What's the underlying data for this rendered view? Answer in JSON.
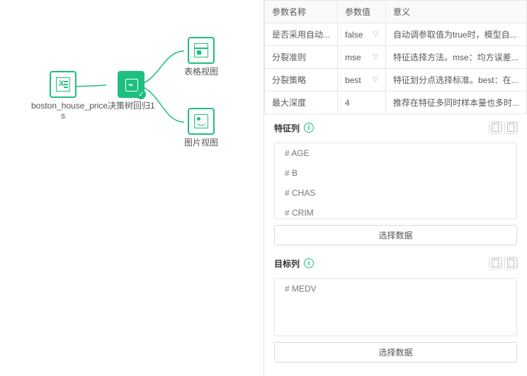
{
  "nodes": {
    "source": {
      "label": "boston_house_price\ns"
    },
    "mid": {
      "label": "决策树回归1"
    },
    "out1": {
      "label": "表格视图"
    },
    "out2": {
      "label": "图片视图"
    }
  },
  "paramTable": {
    "headers": [
      "参数名称",
      "参数值",
      "意义"
    ],
    "rows": [
      {
        "name": "是否采用自动...",
        "value": "false",
        "meaning": "自动调参取值为true时，模型自..."
      },
      {
        "name": "分裂准则",
        "value": "mse",
        "meaning": "特征选择方法。mse：均方误差..."
      },
      {
        "name": "分裂策略",
        "value": "best",
        "meaning": "特征划分点选择标准。best：在..."
      },
      {
        "name": "最大深度",
        "value": "4",
        "meaning": "推荐在特征多同时样本量也多时..."
      }
    ]
  },
  "featureSection": {
    "title": "特征列",
    "items": [
      "AGE",
      "B",
      "CHAS",
      "CRIM"
    ],
    "button": "选择数据"
  },
  "targetSection": {
    "title": "目标列",
    "items": [
      "MEDV"
    ],
    "button": "选择数据"
  },
  "hash": "#"
}
